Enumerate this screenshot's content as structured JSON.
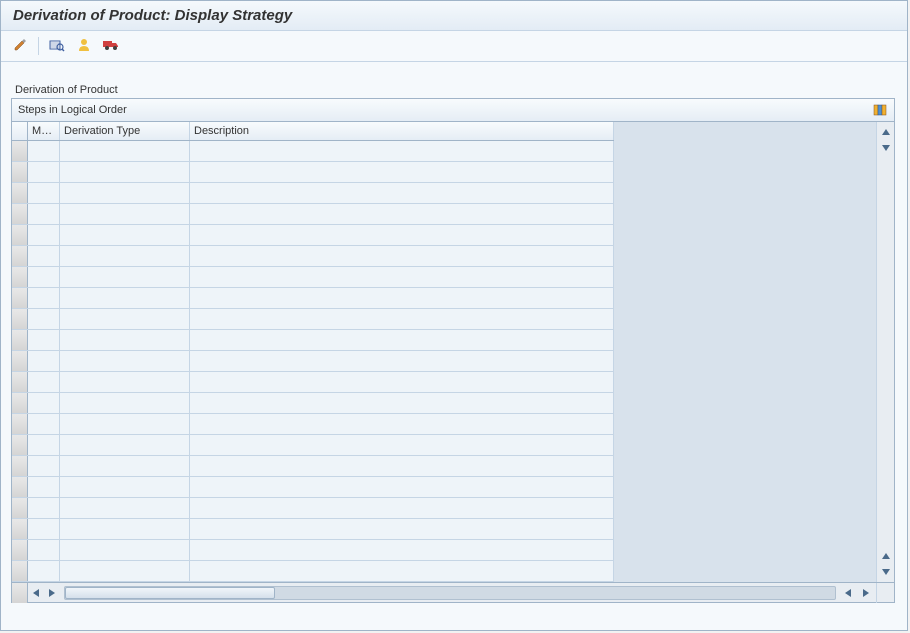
{
  "window": {
    "title": "Derivation of Product: Display Strategy"
  },
  "toolbar": {
    "icons": {
      "edit": "edit-pencil",
      "overview": "magnifier-table",
      "user": "user-yellow",
      "transport": "truck-red"
    }
  },
  "section": {
    "label": "Derivation of Product"
  },
  "table": {
    "title": "Steps in Logical Order",
    "columns": {
      "ma": "Ma...",
      "derivation_type": "Derivation Type",
      "description": "Description"
    },
    "rows": [
      {
        "ma": "",
        "derivation_type": "",
        "description": ""
      },
      {
        "ma": "",
        "derivation_type": "",
        "description": ""
      },
      {
        "ma": "",
        "derivation_type": "",
        "description": ""
      },
      {
        "ma": "",
        "derivation_type": "",
        "description": ""
      },
      {
        "ma": "",
        "derivation_type": "",
        "description": ""
      },
      {
        "ma": "",
        "derivation_type": "",
        "description": ""
      },
      {
        "ma": "",
        "derivation_type": "",
        "description": ""
      },
      {
        "ma": "",
        "derivation_type": "",
        "description": ""
      },
      {
        "ma": "",
        "derivation_type": "",
        "description": ""
      },
      {
        "ma": "",
        "derivation_type": "",
        "description": ""
      },
      {
        "ma": "",
        "derivation_type": "",
        "description": ""
      },
      {
        "ma": "",
        "derivation_type": "",
        "description": ""
      },
      {
        "ma": "",
        "derivation_type": "",
        "description": ""
      },
      {
        "ma": "",
        "derivation_type": "",
        "description": ""
      },
      {
        "ma": "",
        "derivation_type": "",
        "description": ""
      },
      {
        "ma": "",
        "derivation_type": "",
        "description": ""
      },
      {
        "ma": "",
        "derivation_type": "",
        "description": ""
      },
      {
        "ma": "",
        "derivation_type": "",
        "description": ""
      },
      {
        "ma": "",
        "derivation_type": "",
        "description": ""
      },
      {
        "ma": "",
        "derivation_type": "",
        "description": ""
      },
      {
        "ma": "",
        "derivation_type": "",
        "description": ""
      }
    ]
  }
}
